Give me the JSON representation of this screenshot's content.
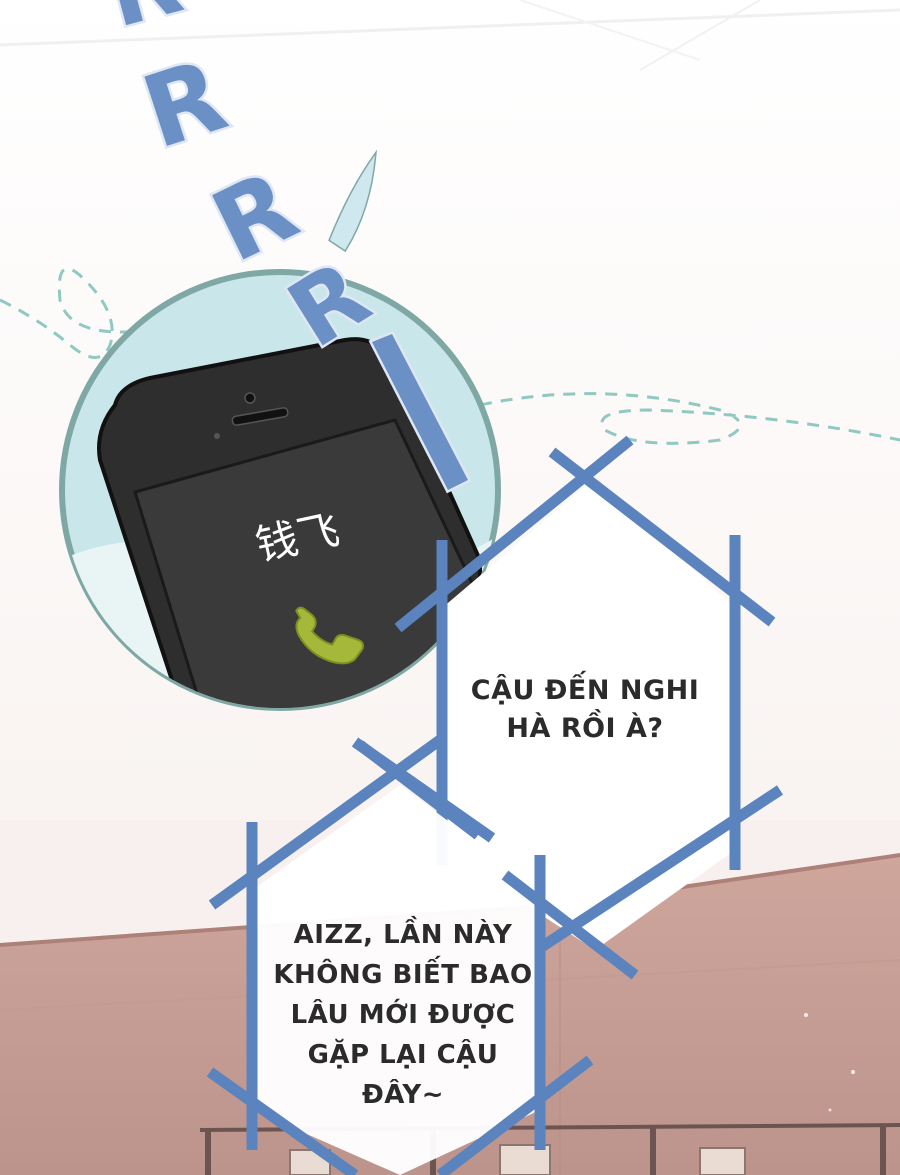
{
  "sound_effect": {
    "letters": [
      "R",
      "R",
      "R",
      "R",
      "I"
    ]
  },
  "phone": {
    "caller_name": "钱飞",
    "call_icon": "phone-handset-icon"
  },
  "speech_bubbles": [
    {
      "text": "CẬU ĐẾN NGHI\nHÀ RỒI À?"
    },
    {
      "text": "AIZZ, LẦN NÀY\nKHÔNG BIẾT BAO\nLÂU MỚI ĐƯỢC\nGẶP LẠI CẬU\nĐÂY~"
    }
  ],
  "colors": {
    "bubble_frame": "#5b83bd",
    "sound_effect": "#6a90c6",
    "sound_effect_outline": "#dfe6f4",
    "phone_circle": "#c9e7ea",
    "phone_circle_border": "#7fa8a5",
    "phone_body": "#2e2e2e",
    "phone_screen": "#3a3a3a",
    "call_icon": "#a6b83a",
    "dashed_line": "#8fc9c2",
    "floor": "#c79c93"
  }
}
